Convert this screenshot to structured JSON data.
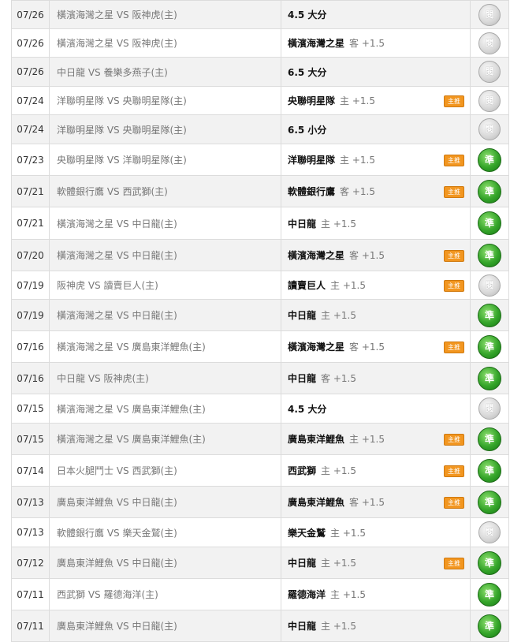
{
  "colors": {
    "accurate": "#2e9e25",
    "read": "#c8c8c8",
    "home_badge": "#f29620",
    "row_alt": "#f2f2f2"
  },
  "vs": "VS",
  "rows": [
    {
      "date": "07/26",
      "away": "橫濱海灣之星",
      "home": "阪神虎(主)",
      "pick_team": "4.5 大分",
      "side": "",
      "badge": "",
      "result": "read",
      "result_label": "閱",
      "result_icon": "read-icon",
      "h": 36
    },
    {
      "date": "07/26",
      "away": "橫濱海灣之星",
      "home": "阪神虎(主)",
      "pick_team": "橫濱海灣之星",
      "side": "客 +1.5",
      "badge": "",
      "result": "read",
      "result_label": "閱",
      "result_icon": "read-icon",
      "h": 36
    },
    {
      "date": "07/26",
      "away": "中日龍",
      "home": "養樂多燕子(主)",
      "pick_team": "6.5 大分",
      "side": "",
      "badge": "",
      "result": "read",
      "result_label": "閱",
      "result_icon": "read-icon",
      "h": 37
    },
    {
      "date": "07/24",
      "away": "洋聯明星隊",
      "home": "央聯明星隊(主)",
      "pick_team": "央聯明星隊",
      "side": "主 +1.5",
      "badge": "主推",
      "result": "read",
      "result_label": "閱",
      "result_icon": "read-icon",
      "h": 36
    },
    {
      "date": "07/24",
      "away": "洋聯明星隊",
      "home": "央聯明星隊(主)",
      "pick_team": "6.5 小分",
      "side": "",
      "badge": "",
      "result": "read",
      "result_label": "閱",
      "result_icon": "read-icon",
      "h": 37
    },
    {
      "date": "07/23",
      "away": "央聯明星隊",
      "home": "洋聯明星隊(主)",
      "pick_team": "洋聯明星隊",
      "side": "主 +1.5",
      "badge": "主推",
      "result": "acc",
      "result_label": "準",
      "result_icon": "accurate-icon",
      "h": 40
    },
    {
      "date": "07/21",
      "away": "軟體銀行鷹",
      "home": "西武獅(主)",
      "pick_team": "軟體銀行鷹",
      "side": "客 +1.5",
      "badge": "主推",
      "result": "acc",
      "result_label": "準",
      "result_icon": "accurate-icon",
      "h": 40
    },
    {
      "date": "07/21",
      "away": "橫濱海灣之星",
      "home": "中日龍(主)",
      "pick_team": "中日龍",
      "side": "主 +1.5",
      "badge": "",
      "result": "acc",
      "result_label": "準",
      "result_icon": "accurate-icon",
      "h": 41
    },
    {
      "date": "07/20",
      "away": "橫濱海灣之星",
      "home": "中日龍(主)",
      "pick_team": "橫濱海灣之星",
      "side": "客 +1.5",
      "badge": "主推",
      "result": "acc",
      "result_label": "準",
      "result_icon": "accurate-icon",
      "h": 40
    },
    {
      "date": "07/19",
      "away": "阪神虎",
      "home": "讀賣巨人(主)",
      "pick_team": "讀賣巨人",
      "side": "主 +1.5",
      "badge": "主推",
      "result": "read",
      "result_label": "閱",
      "result_icon": "read-icon",
      "h": 36
    },
    {
      "date": "07/19",
      "away": "橫濱海灣之星",
      "home": "中日龍(主)",
      "pick_team": "中日龍",
      "side": "主 +1.5",
      "badge": "",
      "result": "acc",
      "result_label": "準",
      "result_icon": "accurate-icon",
      "h": 40
    },
    {
      "date": "07/16",
      "away": "橫濱海灣之星",
      "home": "廣島東洋鯉魚(主)",
      "pick_team": "橫濱海灣之星",
      "side": "客 +1.5",
      "badge": "主推",
      "result": "acc",
      "result_label": "準",
      "result_icon": "accurate-icon",
      "h": 40
    },
    {
      "date": "07/16",
      "away": "中日龍",
      "home": "阪神虎(主)",
      "pick_team": "中日龍",
      "side": "客 +1.5",
      "badge": "",
      "result": "acc",
      "result_label": "準",
      "result_icon": "accurate-icon",
      "h": 40
    },
    {
      "date": "07/15",
      "away": "橫濱海灣之星",
      "home": "廣島東洋鯉魚(主)",
      "pick_team": "4.5 大分",
      "side": "",
      "badge": "",
      "result": "read",
      "result_label": "閱",
      "result_icon": "read-icon",
      "h": 37
    },
    {
      "date": "07/15",
      "away": "橫濱海灣之星",
      "home": "廣島東洋鯉魚(主)",
      "pick_team": "廣島東洋鯉魚",
      "side": "主 +1.5",
      "badge": "主推",
      "result": "acc",
      "result_label": "準",
      "result_icon": "accurate-icon",
      "h": 40
    },
    {
      "date": "07/14",
      "away": "日本火腿鬥士",
      "home": "西武獅(主)",
      "pick_team": "西武獅",
      "side": "主 +1.5",
      "badge": "主推",
      "result": "acc",
      "result_label": "準",
      "result_icon": "accurate-icon",
      "h": 40
    },
    {
      "date": "07/13",
      "away": "廣島東洋鯉魚",
      "home": "中日龍(主)",
      "pick_team": "廣島東洋鯉魚",
      "side": "客 +1.5",
      "badge": "主推",
      "result": "acc",
      "result_label": "準",
      "result_icon": "accurate-icon",
      "h": 40
    },
    {
      "date": "07/13",
      "away": "軟體銀行鷹",
      "home": "樂天金鷲(主)",
      "pick_team": "樂天金鷲",
      "side": "主 +1.5",
      "badge": "",
      "result": "read",
      "result_label": "閱",
      "result_icon": "read-icon",
      "h": 37
    },
    {
      "date": "07/12",
      "away": "廣島東洋鯉魚",
      "home": "中日龍(主)",
      "pick_team": "中日龍",
      "side": "主 +1.5",
      "badge": "主推",
      "result": "acc",
      "result_label": "準",
      "result_icon": "accurate-icon",
      "h": 40
    },
    {
      "date": "07/11",
      "away": "西武獅",
      "home": "羅德海洋(主)",
      "pick_team": "羅德海洋",
      "side": "主 +1.5",
      "badge": "",
      "result": "acc",
      "result_label": "準",
      "result_icon": "accurate-icon",
      "h": 40
    },
    {
      "date": "07/11",
      "away": "廣島東洋鯉魚",
      "home": "中日龍(主)",
      "pick_team": "中日龍",
      "side": "主 +1.5",
      "badge": "",
      "result": "acc",
      "result_label": "準",
      "result_icon": "accurate-icon",
      "h": 40
    }
  ]
}
